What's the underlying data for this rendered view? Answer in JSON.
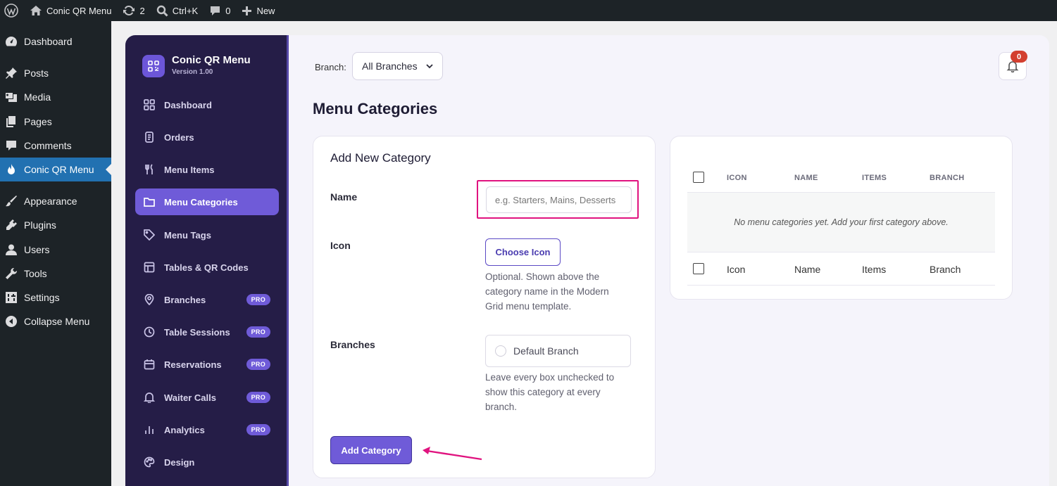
{
  "adminbar": {
    "site_name": "Conic QR Menu",
    "updates_count": "2",
    "search_shortcut": "Ctrl+K",
    "comments_count": "0",
    "new_label": "New"
  },
  "wp_menu": {
    "items": [
      {
        "label": "Dashboard",
        "icon": "dashboard-icon"
      },
      {
        "label": "Posts",
        "icon": "pin-icon"
      },
      {
        "label": "Media",
        "icon": "media-icon"
      },
      {
        "label": "Pages",
        "icon": "pages-icon"
      },
      {
        "label": "Comments",
        "icon": "comments-icon"
      },
      {
        "label": "Conic QR Menu",
        "icon": "flame-icon"
      },
      {
        "label": "Appearance",
        "icon": "brush-icon"
      },
      {
        "label": "Plugins",
        "icon": "plugin-icon"
      },
      {
        "label": "Users",
        "icon": "user-icon"
      },
      {
        "label": "Tools",
        "icon": "wrench-icon"
      },
      {
        "label": "Settings",
        "icon": "settings-icon"
      },
      {
        "label": "Collapse Menu",
        "icon": "collapse-icon"
      }
    ],
    "current": "Conic QR Menu"
  },
  "plugin": {
    "name": "Conic QR Menu",
    "version": "Version 1.00",
    "pro_badge": "PRO",
    "nav": [
      {
        "label": "Dashboard",
        "icon": "grid-icon"
      },
      {
        "label": "Orders",
        "icon": "receipt-icon"
      },
      {
        "label": "Menu Items",
        "icon": "utensils-icon"
      },
      {
        "label": "Menu Categories",
        "icon": "folder-icon"
      },
      {
        "label": "Menu Tags",
        "icon": "tag-icon"
      },
      {
        "label": "Tables & QR Codes",
        "icon": "table-icon"
      },
      {
        "label": "Branches",
        "icon": "location-icon"
      },
      {
        "label": "Table Sessions",
        "icon": "clock-icon"
      },
      {
        "label": "Reservations",
        "icon": "calendar-icon"
      },
      {
        "label": "Waiter Calls",
        "icon": "bell-icon"
      },
      {
        "label": "Analytics",
        "icon": "bar-chart-icon"
      },
      {
        "label": "Design",
        "icon": "palette-icon"
      }
    ],
    "active": "Menu Categories"
  },
  "topbar": {
    "branch_label": "Branch:",
    "branch_value": "All Branches",
    "notifications_count": "0"
  },
  "page_title": "Menu Categories",
  "form": {
    "title": "Add New Category",
    "name_label": "Name",
    "name_placeholder": "e.g. Starters, Mains, Desserts",
    "icon_label": "Icon",
    "choose_icon": "Choose Icon",
    "icon_help": "Optional. Shown above the category name in the Modern Grid menu template.",
    "branches_label": "Branches",
    "branch_option": "Default Branch",
    "branches_help": "Leave every box unchecked to show this category at every branch.",
    "submit": "Add Category"
  },
  "table": {
    "headers": [
      "ICON",
      "NAME",
      "ITEMS",
      "BRANCH"
    ],
    "empty_message": "No menu categories yet. Add your first category above.",
    "footers": [
      "Icon",
      "Name",
      "Items",
      "Branch"
    ]
  },
  "colors": {
    "wp_dark": "#1d2327",
    "wp_accent": "#2271b1",
    "plugin_sidebar": "#251d47",
    "plugin_accent": "#6f5bd8",
    "highlight": "#e0137f",
    "badge_red": "#d33f2f"
  }
}
